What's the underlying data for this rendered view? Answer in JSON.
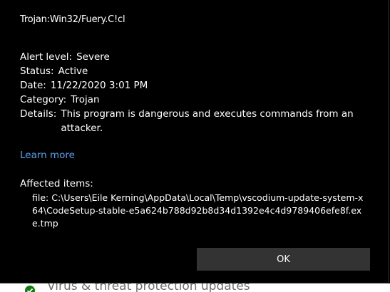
{
  "threat": {
    "name": "Trojan:Win32/Fuery.C!cl"
  },
  "details": {
    "alert_level_label": "Alert level:",
    "alert_level_value": "Severe",
    "status_label": "Status:",
    "status_value": "Active",
    "date_label": "Date:",
    "date_value": "11/22/2020 3:01 PM",
    "category_label": "Category:",
    "category_value": "Trojan",
    "details_label": "Details:",
    "details_value": "This program is dangerous and executes commands from an attacker."
  },
  "learn_more": "Learn more",
  "affected": {
    "label": "Affected items:",
    "file": "file: C:\\Users\\Eile Kerning\\AppData\\Local\\Temp\\vscodium-update-system-x64\\CodeSetup-stable-e5a624b788d92b8d34d1392e4c4d9789406efe8f.exe.tmp"
  },
  "ok_button": "OK",
  "background": {
    "partial_text": "Virus & threat protection updates",
    "icon": "check-icon",
    "accent_color": "#4ea1f3"
  }
}
